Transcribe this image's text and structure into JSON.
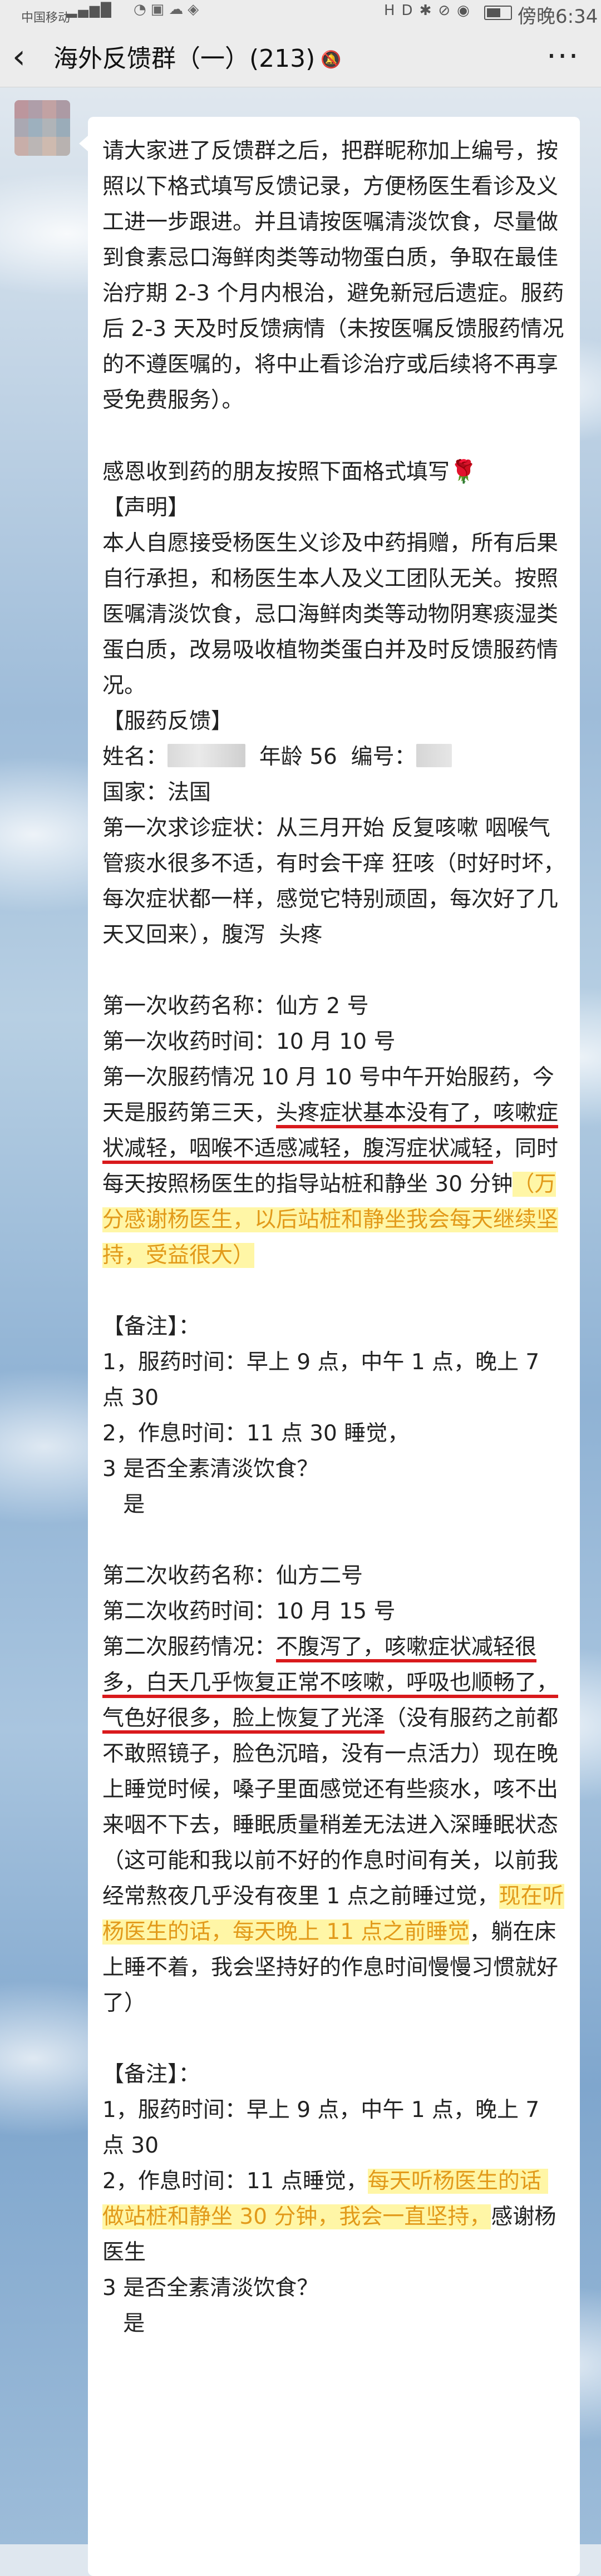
{
  "status_bar": {
    "carrier": "中国移动",
    "time": "傍晚6:34",
    "signal_icon": "signal-icon",
    "battery_icon": "battery-icon"
  },
  "header": {
    "back_icon": "chevron-left-icon",
    "title": "海外反馈群（一）(213)",
    "mute_icon": "mute-bell-icon",
    "more_icon": "more-dots-icon"
  },
  "message": {
    "segments": [
      {
        "t": "请大家进了反馈群之后，把群昵称加上编号，按照以下格式填写反馈记录，方便杨医生看诊及义工进一步跟进。并且请按医嘱清淡饮食，尽量做到食素忌口海鲜肉类等动物蛋白质，争取在最佳治疗期 2-3 个月内根治，避免新冠后遗症。服药后 2-3 天及时反馈病情（未按医嘱反馈服药情况的不遵医嘱的，将中止看诊治疗或后续将不再享受免费服务）。\n\n感恩收到药的朋友按照下面格式填写"
      },
      {
        "icon": "rose-icon"
      },
      {
        "t": "\n【声明】\n本人自愿接受杨医生义诊及中药捐赠，所有后果自行承担，和杨医生本人及义工团队无关。按照医嘱清淡饮食，忌口海鲜肉类等动物阴寒痰湿类蛋白质，改易吸收植物类蛋白并及时反馈服药情况。\n【服药反馈】\n姓名："
      },
      {
        "redact": "name"
      },
      {
        "t": "  年龄 56  编号："
      },
      {
        "redact": "id"
      },
      {
        "t": "\n国家：法国\n第一次求诊症状：从三月开始 反复咳嗽 咽喉气管痰水很多不适，有时会干痒 狂咳（时好时坏，每次症状都一样，感觉它特别顽固，每次好了几天又回来），腹泻  头疼\n\n第一次收药名称：仙方 2 号\n第一次收药时间：10 月 10 号\n第一次服药情况 10 月 10 号中午开始服药，今天是服药第三天，"
      },
      {
        "t": "头疼症状基本没有了，咳嗽症状减轻，咽喉不适感减轻，腹泻症状减轻",
        "style": "u-red"
      },
      {
        "t": "，同时每天按照杨医生的指导站桩和静坐 30 分钟"
      },
      {
        "t": "（万分感谢杨医生，以后站桩和静坐我会每天继续坚持，受益很大）",
        "style": "hl-y"
      },
      {
        "t": "\n\n【备注】：\n1，服药时间：早上 9 点，中午 1 点，晚上 7 点 30\n2，作息时间：11 点 30 睡觉，\n3 是否全素清淡饮食？\n   是\n\n第二次收药名称：仙方二号\n第二次收药时间：10 月 15 号\n第二次服药情况："
      },
      {
        "t": "不腹泻了，咳嗽症状减轻很多，白天几乎恢复正常不咳嗽，呼吸也顺畅了，气色好很多，脸上恢复了光泽",
        "style": "u-red"
      },
      {
        "t": "（没有服药之前都不敢照镜子，脸色沉暗，没有一点活力）现在晚上睡觉时候，嗓子里面感觉还有些痰水，咳不出来咽不下去，睡眠质量稍差无法进入深睡眠状态（这可能和我以前不好的作息时间有关，以前我经常熬夜几乎没有夜里 1 点之前睡过觉，"
      },
      {
        "t": "现在听杨医生的话，每天晚上 11 点之前睡觉",
        "style": "hl-y"
      },
      {
        "t": "，躺在床上睡不着，我会坚持好的作息时间慢慢习惯就好了）\n\n【备注】：\n1，服药时间：早上 9 点，中午 1 点，晚上 7 点 30\n2，作息时间：11 点睡觉，"
      },
      {
        "t": "每天听杨医生的话 做站桩和静坐 30 分钟，我会一直坚持，",
        "style": "hl-y"
      },
      {
        "t": "感谢杨医生\n3 是否全素清淡饮食？\n   是"
      }
    ]
  },
  "colors": {
    "underline": "#d9191c",
    "highlight_bg": "#fff6a6",
    "highlight_text": "#e29a1a",
    "bubble_bg": "#ffffff",
    "bar_bg": "#ececec"
  }
}
